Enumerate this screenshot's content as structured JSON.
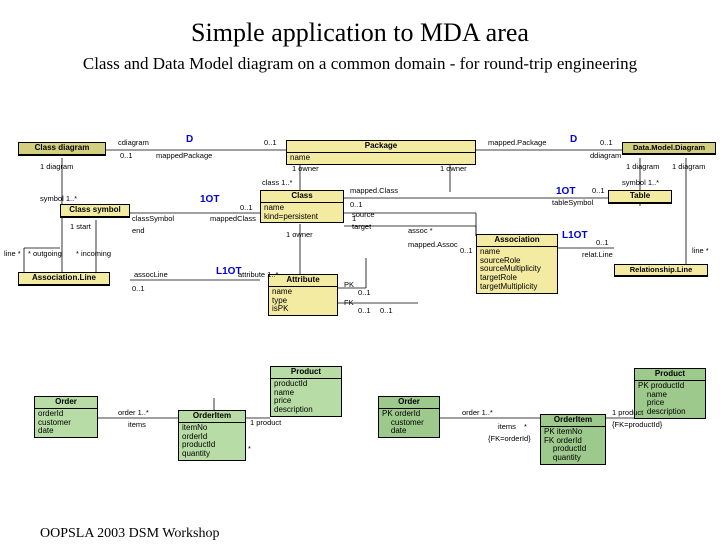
{
  "title": "Simple application to MDA area",
  "subtitle": "Class and Data Model diagram on a common domain - for round-trip engineering",
  "footer": "OOPSLA 2003 DSM Workshop",
  "labels": {
    "D1": "D",
    "D2": "D",
    "OT1": "1OT",
    "OT2": "1OT",
    "L1OT1": "L1OT",
    "L1OT2": "L1OT",
    "cdiagram": "cdiagram",
    "mappedPackage": "mappedPackage",
    "mappedPackage2": "mapped.Package",
    "ddiagram": "ddiagram",
    "zero_one_a": "0..1",
    "zero_one_b": "0..1",
    "zero_one_c": "0..1",
    "zero_one_d": "0..1",
    "zero_one_e": "0..1",
    "zero_one_f": "0..1",
    "zero_one_g": "0..1",
    "zero_one_h": "0..1",
    "zero_one_i": "0..1",
    "zero_one_j": "0..1",
    "zero_one_k": "0..1",
    "zero_one_l": "0..1",
    "one_diag1": "1 diagram",
    "one_diag2": "1 diagram",
    "one_diag3": "1 diagram",
    "owner1": "1 owner",
    "owner2": "1 owner",
    "owner3": "1 owner",
    "class_star": "class 1..*",
    "symbol1": "symbol 1..*",
    "symbol2": "symbol 1..*",
    "classSymbol": "classSymbol",
    "mappedClass": "mappedClass",
    "mappedClass2": "mapped.Class",
    "tableSymbol": "tableSymbol",
    "source": "source",
    "target": "target",
    "assoc": "assoc *",
    "mappedAssoc": "mapped.Assoc",
    "relatLine": "relat.Line",
    "attribute": "attribute 1..*",
    "assocLine": "assocLine",
    "PK": "PK",
    "FK": "FK",
    "end": "end",
    "start": "1 start",
    "outgoing": "* outgoing",
    "incoming": "* incoming",
    "line": "line *",
    "line2": "line *",
    "order_rel": "order 1..*",
    "items": "items",
    "one": "1",
    "product_rel": "1 product",
    "star": "*",
    "order_rel2": "order 1..*",
    "items2": "items",
    "star2": "*",
    "fk_orderid": "{FK=orderId}",
    "fk_productid": "{FK=productId}",
    "one_product": "1 product"
  },
  "boxes": {
    "classDiagram": {
      "hdr": "Class diagram"
    },
    "package": {
      "hdr": "Package",
      "body": "name"
    },
    "dmDiagram": {
      "hdr": "Data.Model.Diagram"
    },
    "classSymbol": {
      "hdr": "Class symbol"
    },
    "class": {
      "hdr": "Class",
      "body": "name\nkind=persistent"
    },
    "table": {
      "hdr": "Table"
    },
    "assocLine": {
      "hdr": "Association.Line"
    },
    "attribute": {
      "hdr": "Attribute",
      "body": "name\ntype\nisPK"
    },
    "association": {
      "hdr": "Association",
      "body": "name\nsourceRole\nsourceMultiplicity\ntargetRole\ntargetMultiplicity"
    },
    "relLine": {
      "hdr": "Relationship.Line"
    },
    "order1": {
      "hdr": "Order",
      "body": "orderId\ncustomer\ndate"
    },
    "product1": {
      "hdr": "Product",
      "body": "productId\nname\nprice\ndescription"
    },
    "orderItem1": {
      "hdr": "OrderItem",
      "body": "itemNo\norderId\nproductId\nquantity"
    },
    "order2": {
      "hdr": "Order",
      "body": "PK orderId\n    customer\n    date"
    },
    "product2": {
      "hdr": "Product",
      "body": "PK productId\n    name\n    price\n    description"
    },
    "orderItem2": {
      "hdr": "OrderItem",
      "body": "PK itemNo\nFK orderId\n    productId\n    quantity"
    }
  }
}
